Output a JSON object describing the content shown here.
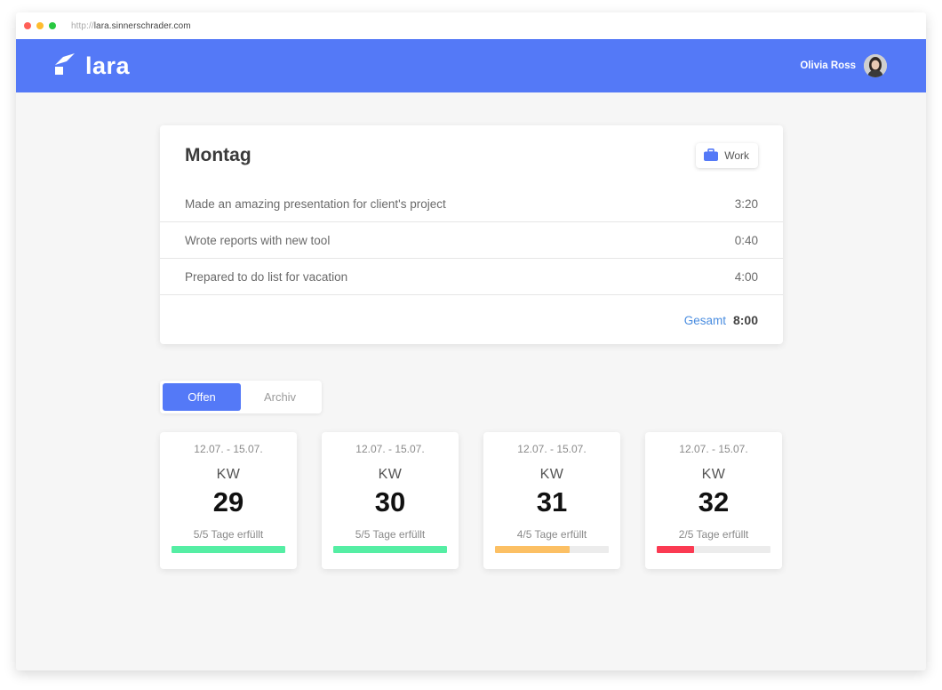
{
  "browser": {
    "url_protocol": "http://",
    "url_host": "lara.sinnerschrader.com",
    "dot_colors": [
      "#ff5f57",
      "#febc2e",
      "#28c840"
    ]
  },
  "header": {
    "logo_text": "lara",
    "user_name": "Olivia Ross",
    "bg_color": "#5479f7"
  },
  "day_card": {
    "title": "Montag",
    "tag_label": "Work",
    "tag_icon": "briefcase-icon",
    "entries": [
      {
        "description": "Made an amazing presentation for client's project",
        "time": "3:20"
      },
      {
        "description": "Wrote reports with new tool",
        "time": "0:40"
      },
      {
        "description": "Prepared to do list for vacation",
        "time": "4:00"
      }
    ],
    "total_label": "Gesamt",
    "total_value": "8:00"
  },
  "tabs": [
    {
      "label": "Offen",
      "active": true
    },
    {
      "label": "Archiv",
      "active": false
    }
  ],
  "weeks": [
    {
      "range": "12.07. - 15.07.",
      "kw_label": "KW",
      "number": "29",
      "status": "5/5 Tage erfüllt",
      "progress": 1.0,
      "color": "#55eea4"
    },
    {
      "range": "12.07. - 15.07.",
      "kw_label": "KW",
      "number": "30",
      "status": "5/5 Tage erfüllt",
      "progress": 1.0,
      "color": "#55eea4"
    },
    {
      "range": "12.07. - 15.07.",
      "kw_label": "KW",
      "number": "31",
      "status": "4/5 Tage erfüllt",
      "progress": 0.66,
      "color": "#fcc064"
    },
    {
      "range": "12.07. - 15.07.",
      "kw_label": "KW",
      "number": "32",
      "status": "2/5 Tage erfüllt",
      "progress": 0.33,
      "color": "#fb3a52"
    }
  ]
}
